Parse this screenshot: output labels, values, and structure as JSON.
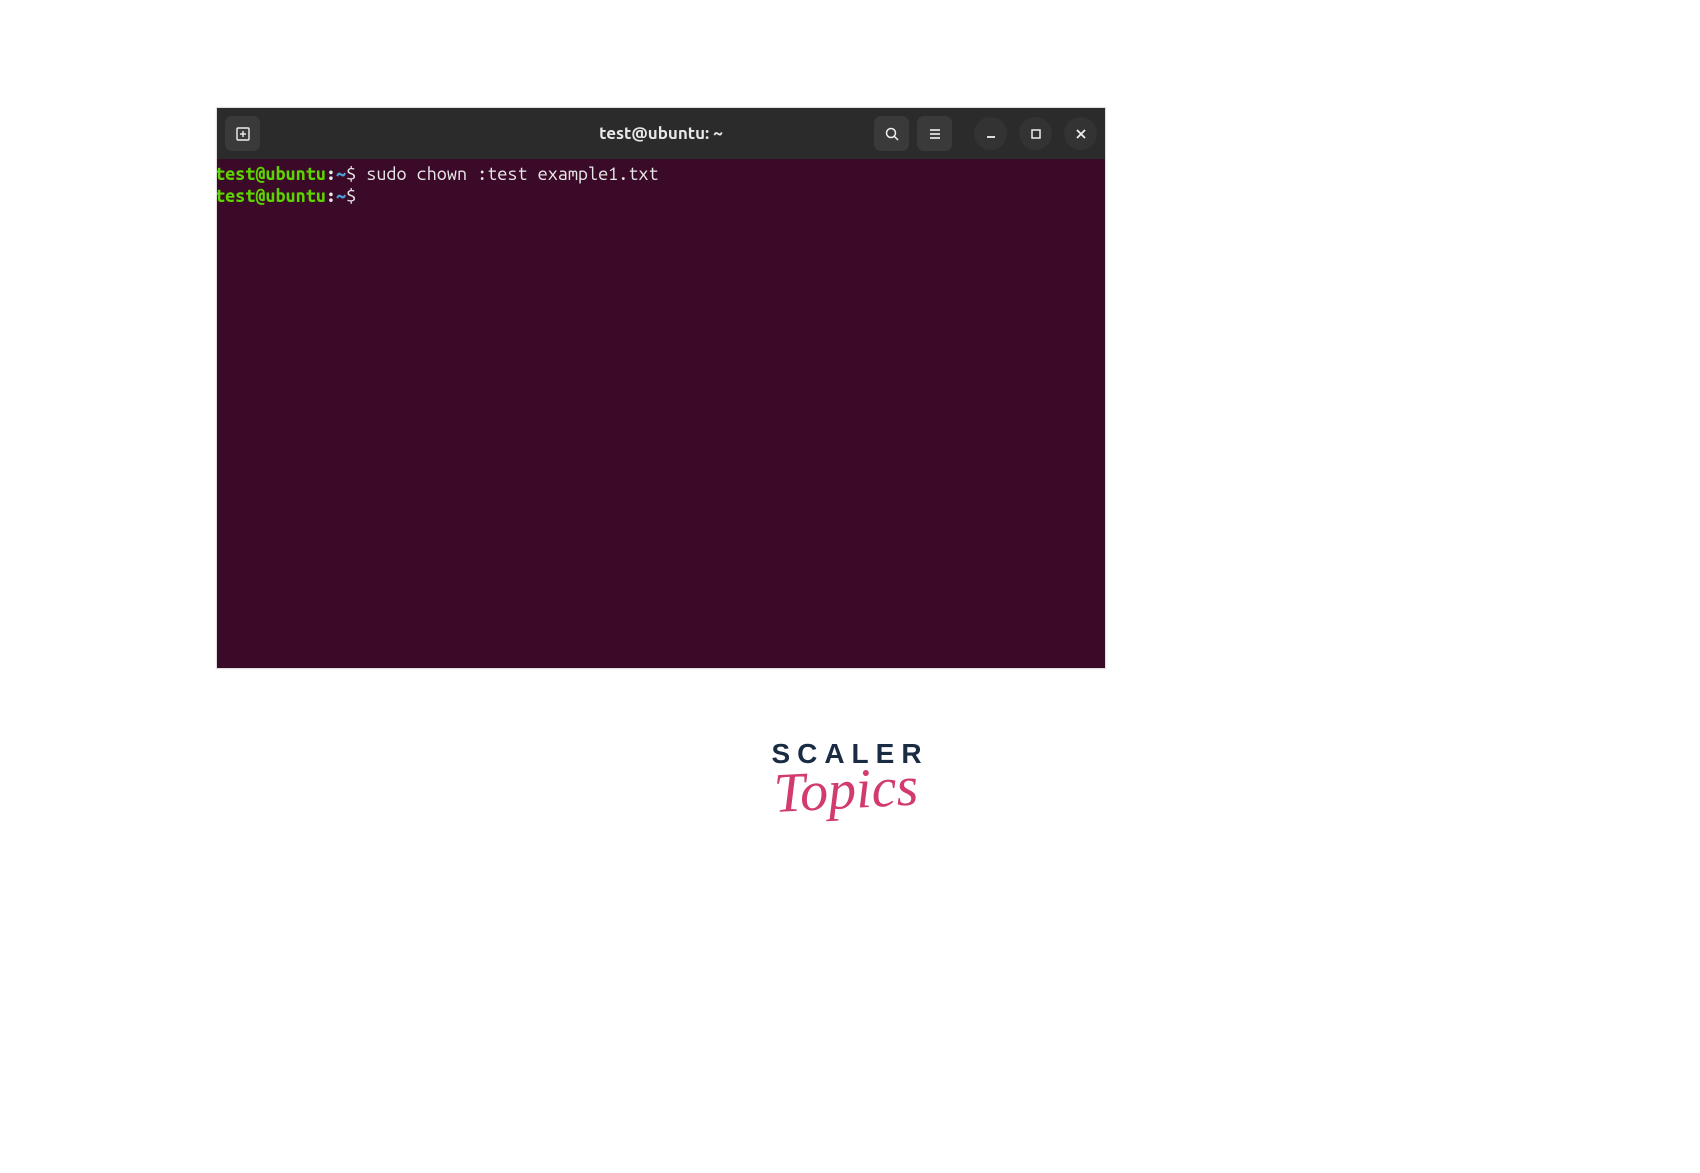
{
  "window": {
    "title": "test@ubuntu: ~"
  },
  "terminal": {
    "lines": [
      {
        "user": "test@ubuntu",
        "colon": ":",
        "path": "~",
        "dollar": "$ ",
        "command": "sudo chown :test example1.txt"
      },
      {
        "user": "test@ubuntu",
        "colon": ":",
        "path": "~",
        "dollar": "$ ",
        "command": ""
      }
    ]
  },
  "icons": {
    "new_tab": "new-tab-icon",
    "search": "search-icon",
    "menu": "hamburger-icon",
    "minimize": "minimize-icon",
    "maximize": "maximize-icon",
    "close": "close-icon"
  },
  "logo": {
    "line1": "SCALER",
    "line2": "Topics"
  }
}
